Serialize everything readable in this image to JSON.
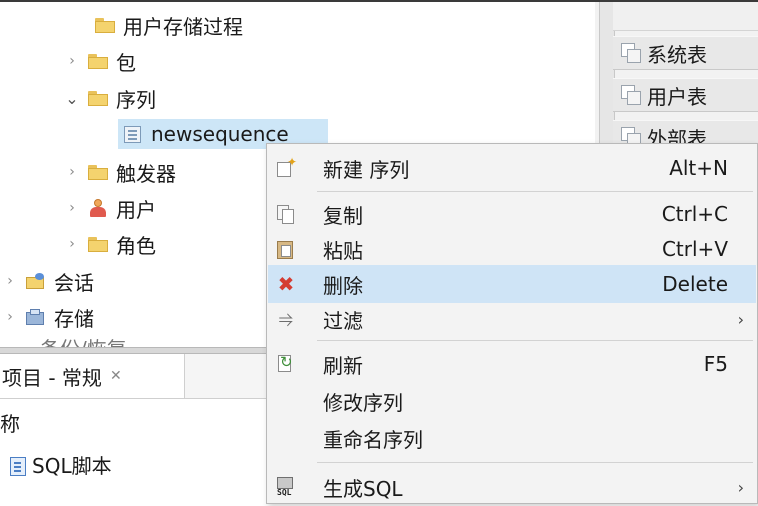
{
  "tree": {
    "items": [
      {
        "label": "用户存储过程",
        "expand": ""
      },
      {
        "label": "包",
        "expand": "›"
      },
      {
        "label": "序列",
        "expand": "⌄"
      },
      {
        "label": "newsequence",
        "expand": ""
      },
      {
        "label": "触发器",
        "expand": "›"
      },
      {
        "label": "用户",
        "expand": "›"
      },
      {
        "label": "角色",
        "expand": "›"
      },
      {
        "label": "会话",
        "expand": "›"
      },
      {
        "label": "存储",
        "expand": "›"
      }
    ],
    "cut_off_label": "备份/恢复"
  },
  "right_panel": {
    "items": [
      {
        "label": "系统表"
      },
      {
        "label": "用户表"
      },
      {
        "label": "外部表"
      }
    ]
  },
  "bottom_panel": {
    "tab_label": "项目 - 常规",
    "tab_close": "✕",
    "name_label": "称",
    "file_label": "SQL脚本"
  },
  "context_menu": {
    "items": [
      {
        "label": "新建 序列",
        "accelerator": "Alt+N",
        "icon": "new-icon"
      },
      {
        "label": "复制",
        "accelerator": "Ctrl+C",
        "icon": "copy-icon"
      },
      {
        "label": "粘贴",
        "accelerator": "Ctrl+V",
        "icon": "paste-icon"
      },
      {
        "label": "删除",
        "accelerator": "Delete",
        "icon": "delete-icon"
      },
      {
        "label": "过滤",
        "accelerator": "",
        "icon": "filter-icon"
      },
      {
        "label": "刷新",
        "accelerator": "F5",
        "icon": "refresh-icon"
      },
      {
        "label": "修改序列",
        "accelerator": "",
        "icon": ""
      },
      {
        "label": "重命名序列",
        "accelerator": "",
        "icon": ""
      },
      {
        "label": "生成SQL",
        "accelerator": "",
        "icon": "sql-icon"
      }
    ],
    "submenu_arrow": "›",
    "delete_glyph": "✖",
    "filter_glyph": "⥤"
  },
  "colors": {
    "selection": "#cde6f7",
    "menu_highlight": "#cfe4f6",
    "folder": "#f4d36e"
  }
}
